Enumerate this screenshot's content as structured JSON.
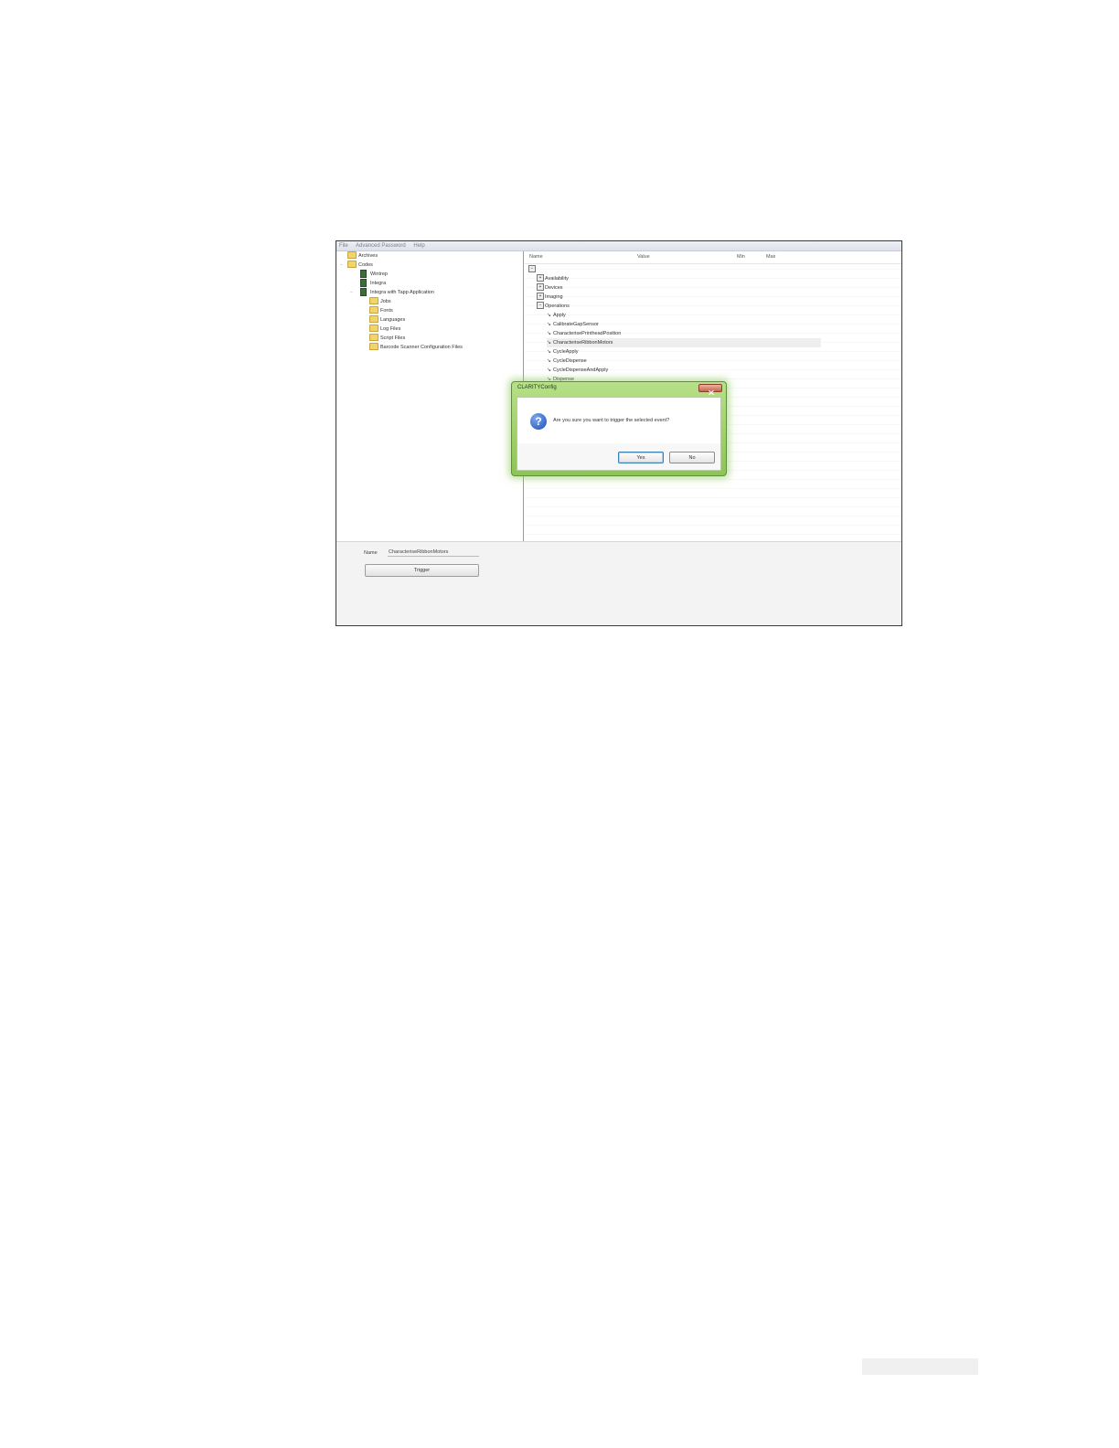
{
  "menu": [
    "File",
    "Advanced Password",
    "Help"
  ],
  "tree": [
    {
      "label": "Archives",
      "icon": "folder-icon",
      "expander": ""
    },
    {
      "label": "Codes",
      "icon": "folder-icon",
      "expander": "−"
    },
    {
      "label": "Wintrep",
      "icon": "printer-device-icon",
      "expander": ""
    },
    {
      "label": "Integra",
      "icon": "printer-device-icon",
      "expander": ""
    },
    {
      "label": "Integra with Tapp Application",
      "icon": "printer-device-icon",
      "expander": "−"
    },
    {
      "label": "Jobs",
      "icon": "folder-icon",
      "expander": ""
    },
    {
      "label": "Fonts",
      "icon": "folder-icon",
      "expander": ""
    },
    {
      "label": "Languages",
      "icon": "folder-icon",
      "expander": ""
    },
    {
      "label": "Log Files",
      "icon": "folder-icon",
      "expander": ""
    },
    {
      "label": "Script Files",
      "icon": "folder-icon",
      "expander": ""
    },
    {
      "label": "Barcode Scanner Configuration Files",
      "icon": "folder-icon",
      "expander": ""
    }
  ],
  "grid": {
    "columns": [
      "Name",
      "Value",
      "Min",
      "Max"
    ],
    "categories": [
      "Availability",
      "Devices",
      "Imaging",
      "Operations"
    ],
    "events": [
      "Apply",
      "CalibrateGapSensor",
      "CharacterisePrintheadPosition",
      "CharacteriseRibbonMotors",
      "CycleApply",
      "CycleDispense",
      "CycleDispenseAndApply",
      "Dispense"
    ],
    "selected_event": "CharacteriseRibbonMotors"
  },
  "bottom": {
    "name_label": "Name",
    "name_value": "CharacteriseRibbonMotors",
    "trigger_label": "Trigger"
  },
  "dialog": {
    "title": "CLARITYConfig",
    "message": "Are you sure you want to trigger the selected event?",
    "yes_label": "Yes",
    "no_label": "No",
    "icon": "question-icon"
  },
  "colors": {
    "dialog_frame": "#8cc552",
    "question_icon": "#1c4fb8",
    "close_button": "#c7644a",
    "folder": "#f3d46b"
  }
}
